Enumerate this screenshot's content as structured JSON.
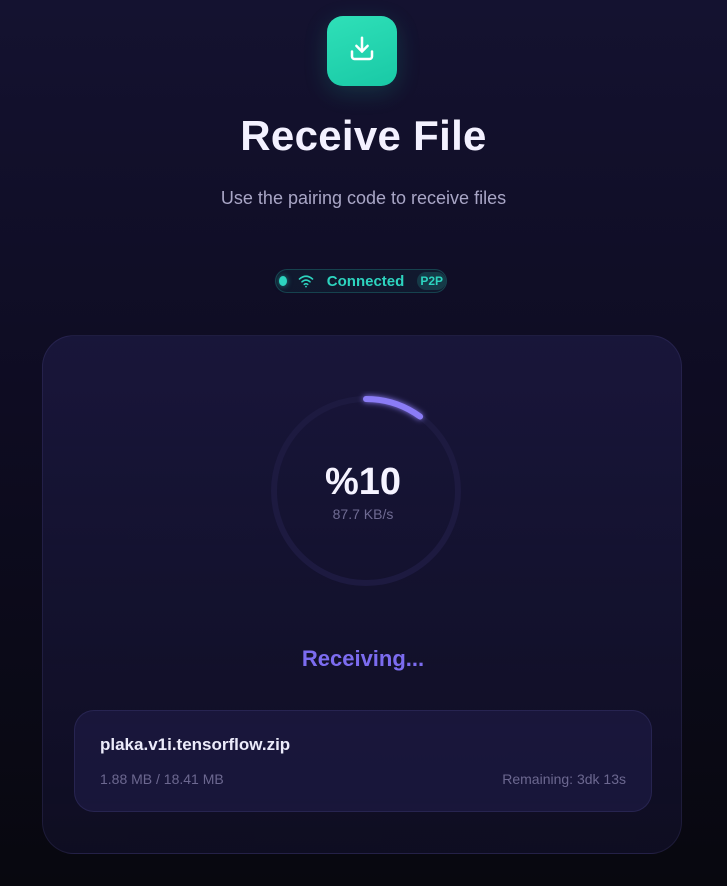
{
  "header": {
    "icon": "download-icon",
    "title": "Receive File",
    "subtitle": "Use the pairing code to receive files"
  },
  "connection": {
    "status_icon": "wifi-icon",
    "status": "Connected",
    "badge": "P2P"
  },
  "progress": {
    "percent_label": "%10",
    "percent_value": 10,
    "speed": "87.7 KB/s",
    "status": "Receiving..."
  },
  "file": {
    "name": "plaka.v1i.tensorflow.zip",
    "size": "1.88 MB / 18.41 MB",
    "remaining": "Remaining: 3dk 13s"
  },
  "colors": {
    "accent_teal": "#2dd4bf",
    "accent_purple": "#7c6cf0",
    "background": "#0e0c22"
  }
}
